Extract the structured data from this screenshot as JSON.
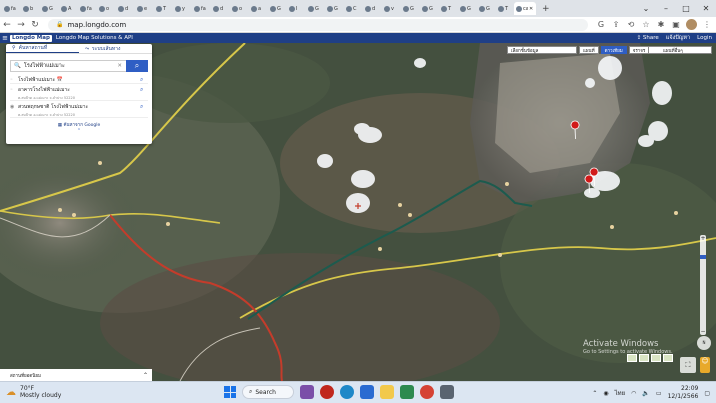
{
  "browser": {
    "tabs": [
      {
        "label": "fa"
      },
      {
        "label": "b"
      },
      {
        "label": "G"
      },
      {
        "label": "A"
      },
      {
        "label": "fa"
      },
      {
        "label": "o"
      },
      {
        "label": "d"
      },
      {
        "label": "e"
      },
      {
        "label": "T"
      },
      {
        "label": "y"
      },
      {
        "label": "fa"
      },
      {
        "label": "d"
      },
      {
        "label": "o"
      },
      {
        "label": "a"
      },
      {
        "label": "G"
      },
      {
        "label": "I"
      },
      {
        "label": "G"
      },
      {
        "label": "G"
      },
      {
        "label": "C"
      },
      {
        "label": "d"
      },
      {
        "label": "v"
      },
      {
        "label": "G"
      },
      {
        "label": "G"
      },
      {
        "label": "T"
      },
      {
        "label": "G"
      },
      {
        "label": "G"
      },
      {
        "label": "T"
      },
      {
        "label": "ca",
        "active": true
      }
    ],
    "url": "map.longdo.com"
  },
  "header": {
    "logo": "Longdo Map",
    "title": "Longdo Map Solutions & API",
    "share": "Share",
    "help": "แจ้งปัญหา",
    "login": "Login"
  },
  "panel": {
    "tab_search": "ค้นหาสถานที่",
    "tab_route": "ระบบเส้นทาง",
    "search_value": "โรงไฟฟ้าแม่เมาะ",
    "results": [
      {
        "name": "โรงไฟฟ้าแม่เมาะ 📅",
        "sub": ""
      },
      {
        "name": "อาคารโรงไฟฟ้าแม่เมาะ",
        "sub": "ต.สบป้าด อ.แม่เมาะ จ.ลำปาง 52220"
      },
      {
        "name": "สวนพฤกษชาติ โรงไฟฟ้าแม่เมาะ",
        "sub": "ต.สบป้าด อ.แม่เมาะ จ.ลำปาง 52220"
      }
    ],
    "google_link": "ค้นหาจาก Google"
  },
  "map_controls": {
    "layer_select": "เลือกชั้นข้อมูล",
    "btn_normal": "แผนที่",
    "btn_satellite": "ดาวเทียม",
    "btn_traffic": "จราจร",
    "right_select": "แผนที่อื่นๆ",
    "zoom_plus": "+",
    "zoom_minus": "−",
    "compass": "N",
    "bottom_label": "สถานที่ยอดนิยม"
  },
  "watermark": {
    "line1": "Activate Windows",
    "line2": "Go to Settings to activate Windows."
  },
  "taskbar": {
    "temp": "70°F",
    "condition": "Mostly cloudy",
    "search": "Search",
    "lang": "ไทย",
    "time": "22:09",
    "date": "12/1/2566"
  },
  "colors": {
    "longdo_blue": "#1f3f86",
    "accent": "#2f5ec4",
    "route_teal": "#1c5b4e",
    "road_red": "#c43c2b",
    "road_yellow": "#d7c74a",
    "pin_red": "#d11a1a"
  }
}
